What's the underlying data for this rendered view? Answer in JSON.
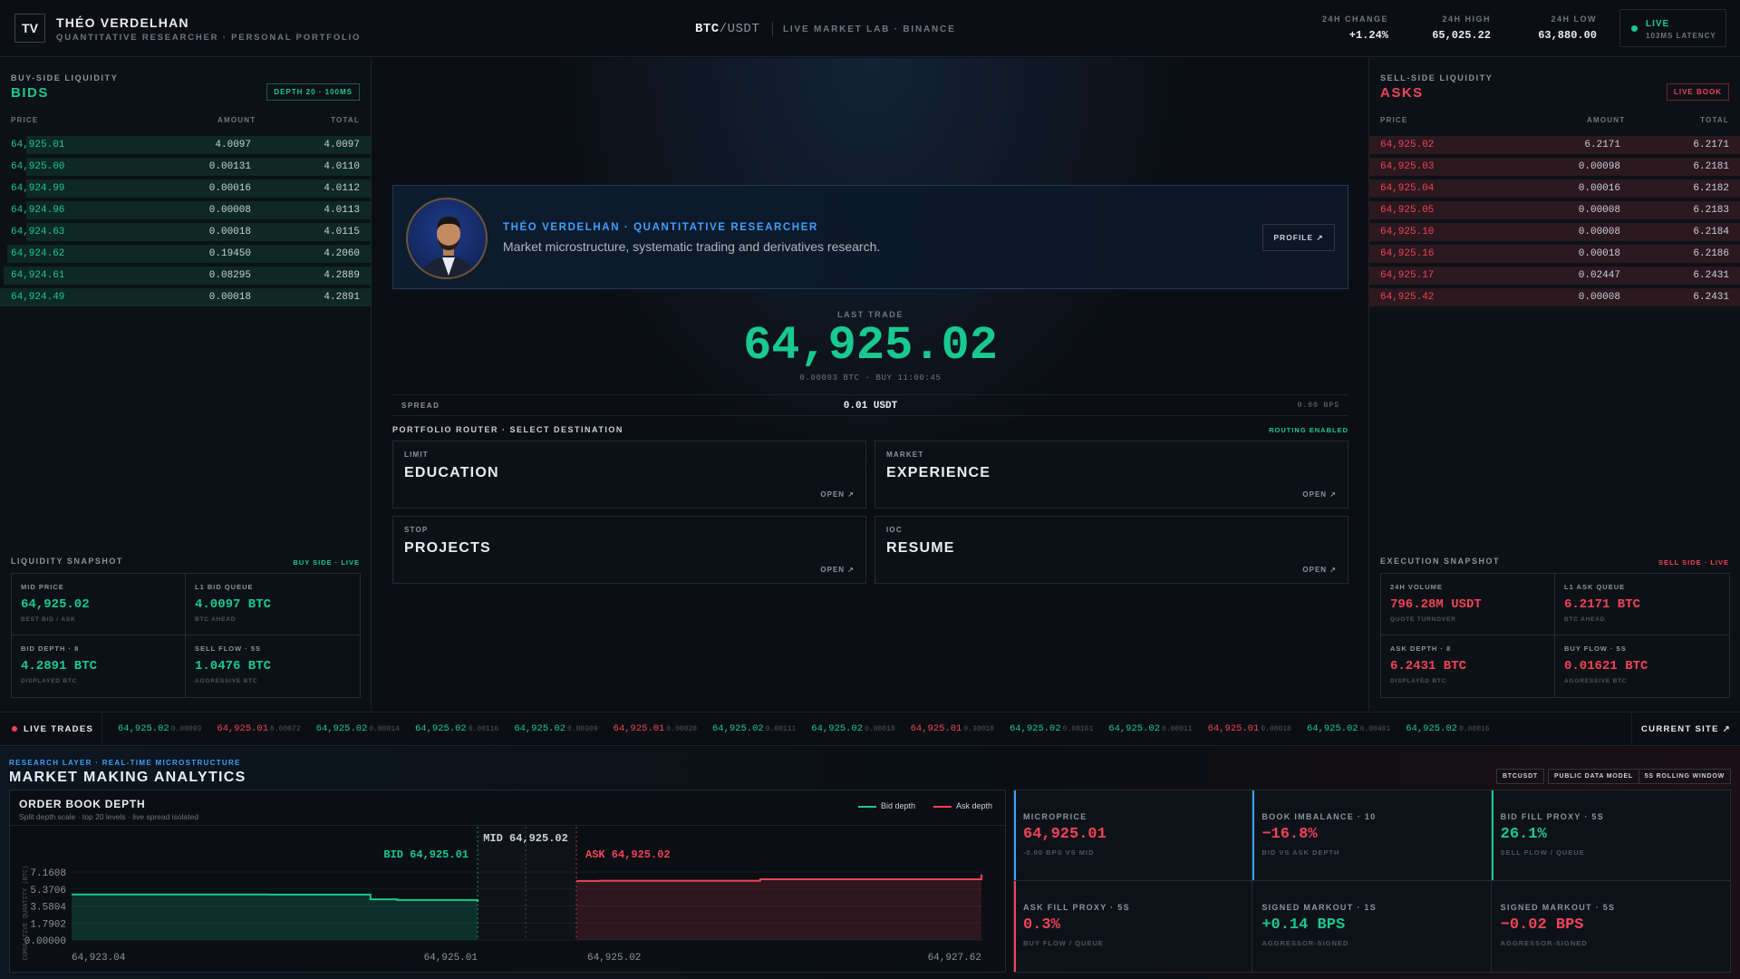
{
  "header": {
    "logo": "TV",
    "name": "THÉO VERDELHAN",
    "subtitle": "QUANTITATIVE RESEARCHER · PERSONAL PORTFOLIO",
    "pair_base": "BTC",
    "pair_quote": "/USDT",
    "lab": "LIVE MARKET LAB · BINANCE",
    "stats": [
      {
        "label": "24H CHANGE",
        "value": "+1.24%"
      },
      {
        "label": "24H HIGH",
        "value": "65,025.22"
      },
      {
        "label": "24H LOW",
        "value": "63,880.00"
      }
    ],
    "live": "LIVE",
    "latency": "103MS LATENCY"
  },
  "bids": {
    "kicker": "BUY-SIDE LIQUIDITY",
    "title": "BIDS",
    "badge": "DEPTH 20 · 100MS",
    "cols": [
      "PRICE",
      "AMOUNT",
      "TOTAL"
    ],
    "rows": [
      {
        "p": "64,925.01",
        "a": "4.0097",
        "t": "4.0097",
        "f": 0.93
      },
      {
        "p": "64,925.00",
        "a": "0.00131",
        "t": "4.0110",
        "f": 0.93
      },
      {
        "p": "64,924.99",
        "a": "0.00016",
        "t": "4.0112",
        "f": 0.93
      },
      {
        "p": "64,924.96",
        "a": "0.00008",
        "t": "4.0113",
        "f": 0.93
      },
      {
        "p": "64,924.63",
        "a": "0.00018",
        "t": "4.0115",
        "f": 0.93
      },
      {
        "p": "64,924.62",
        "a": "0.19450",
        "t": "4.2060",
        "f": 0.98
      },
      {
        "p": "64,924.61",
        "a": "0.08295",
        "t": "4.2889",
        "f": 0.99
      },
      {
        "p": "64,924.49",
        "a": "0.00018",
        "t": "4.2891",
        "f": 1.0
      }
    ],
    "snap_title": "LIQUIDITY SNAPSHOT",
    "snap_badge": "BUY SIDE · LIVE",
    "snap": [
      {
        "l": "MID PRICE",
        "v": "64,925.02",
        "s": "BEST BID / ASK"
      },
      {
        "l": "L1 BID QUEUE",
        "v": "4.0097 BTC",
        "s": "BTC AHEAD"
      },
      {
        "l": "BID DEPTH · 8",
        "v": "4.2891 BTC",
        "s": "DISPLAYED BTC"
      },
      {
        "l": "SELL FLOW · 5S",
        "v": "1.0476 BTC",
        "s": "AGGRESSIVE BTC"
      }
    ]
  },
  "asks": {
    "kicker": "SELL-SIDE LIQUIDITY",
    "title": "ASKS",
    "badge": "LIVE BOOK",
    "cols": [
      "PRICE",
      "AMOUNT",
      "TOTAL"
    ],
    "rows": [
      {
        "p": "64,925.02",
        "a": "6.2171",
        "t": "6.2171",
        "f": 1.0
      },
      {
        "p": "64,925.03",
        "a": "0.00098",
        "t": "6.2181",
        "f": 1.0
      },
      {
        "p": "64,925.04",
        "a": "0.00016",
        "t": "6.2182",
        "f": 1.0
      },
      {
        "p": "64,925.05",
        "a": "0.00008",
        "t": "6.2183",
        "f": 1.0
      },
      {
        "p": "64,925.10",
        "a": "0.00008",
        "t": "6.2184",
        "f": 1.0
      },
      {
        "p": "64,925.16",
        "a": "0.00018",
        "t": "6.2186",
        "f": 1.0
      },
      {
        "p": "64,925.17",
        "a": "0.02447",
        "t": "6.2431",
        "f": 1.0
      },
      {
        "p": "64,925.42",
        "a": "0.00008",
        "t": "6.2431",
        "f": 1.0
      }
    ],
    "snap_title": "EXECUTION SNAPSHOT",
    "snap_badge": "SELL SIDE · LIVE",
    "snap": [
      {
        "l": "24H VOLUME",
        "v": "796.28M USDT",
        "s": "QUOTE TURNOVER"
      },
      {
        "l": "L1 ASK QUEUE",
        "v": "6.2171 BTC",
        "s": "BTC AHEAD"
      },
      {
        "l": "ASK DEPTH · 8",
        "v": "6.2431 BTC",
        "s": "DISPLAYED BTC"
      },
      {
        "l": "BUY FLOW · 5S",
        "v": "0.01621 BTC",
        "s": "AGGRESSIVE BTC"
      }
    ]
  },
  "profile": {
    "name": "THÉO VERDELHAN · QUANTITATIVE RESEARCHER",
    "desc": "Market microstructure, systematic trading and derivatives research.",
    "button": "PROFILE ↗"
  },
  "trade": {
    "label": "LAST TRADE",
    "price": "64,925.02",
    "meta": "0.00093 BTC · BUY 11:00:45",
    "spread_label": "SPREAD",
    "spread": "0.01 USDT",
    "spread_bps": "0.00 BPS"
  },
  "router": {
    "title": "PORTFOLIO ROUTER · SELECT DESTINATION",
    "badge": "ROUTING ENABLED",
    "items": [
      {
        "kind": "LIMIT",
        "name": "EDUCATION",
        "open": "OPEN ↗"
      },
      {
        "kind": "MARKET",
        "name": "EXPERIENCE",
        "open": "OPEN ↗"
      },
      {
        "kind": "STOP",
        "name": "PROJECTS",
        "open": "OPEN ↗"
      },
      {
        "kind": "IOC",
        "name": "RESUME",
        "open": "OPEN ↗"
      }
    ]
  },
  "ticker": {
    "label": "LIVE TRADES",
    "current": "CURRENT SITE ↗",
    "items": [
      {
        "p": "64,925.02",
        "q": "0.00093",
        "side": "buy"
      },
      {
        "p": "64,925.01",
        "q": "0.00072",
        "side": "sell"
      },
      {
        "p": "64,925.02",
        "q": "0.00014",
        "side": "buy"
      },
      {
        "p": "64,925.02",
        "q": "0.00116",
        "side": "buy"
      },
      {
        "p": "64,925.02",
        "q": "0.00309",
        "side": "buy"
      },
      {
        "p": "64,925.01",
        "q": "0.00020",
        "side": "sell"
      },
      {
        "p": "64,925.02",
        "q": "0.00111",
        "side": "buy"
      },
      {
        "p": "64,925.02",
        "q": "0.00018",
        "side": "buy"
      },
      {
        "p": "64,925.01",
        "q": "0.30018",
        "side": "sell"
      },
      {
        "p": "64,925.02",
        "q": "0.00161",
        "side": "buy"
      },
      {
        "p": "64,925.02",
        "q": "0.00011",
        "side": "buy"
      },
      {
        "p": "64,925.01",
        "q": "0.00018",
        "side": "sell"
      },
      {
        "p": "64,925.02",
        "q": "0.00401",
        "side": "buy"
      },
      {
        "p": "64,925.02",
        "q": "0.00016",
        "side": "buy"
      }
    ]
  },
  "analytics": {
    "tag": "RESEARCH LAYER · REAL-TIME MICROSTRUCTURE",
    "title": "MARKET MAKING ANALYTICS",
    "chips": [
      "BTCUSDT",
      "PUBLIC DATA MODEL",
      "5S ROLLING WINDOW"
    ],
    "metrics": [
      {
        "l": "MICROPRICE",
        "v": "64,925.01",
        "s": "-0.00 BPS VS MID",
        "c": "red",
        "a": "#3ea0ff"
      },
      {
        "l": "BOOK IMBALANCE · 10",
        "v": "−16.8%",
        "s": "BID VS ASK DEPTH",
        "c": "red",
        "a": "#3ea0ff"
      },
      {
        "l": "BID FILL PROXY · 5S",
        "v": "26.1%",
        "s": "SELL FLOW / QUEUE",
        "c": "green",
        "a": "#19c98f"
      },
      {
        "l": "ASK FILL PROXY · 5S",
        "v": "0.3%",
        "s": "BUY FLOW / QUEUE",
        "c": "red",
        "a": "#f0445a"
      },
      {
        "l": "SIGNED MARKOUT · 1S",
        "v": "+0.14 BPS",
        "s": "AGGRESSOR-SIGNED",
        "c": "green",
        "a": "none"
      },
      {
        "l": "SIGNED MARKOUT · 5S",
        "v": "−0.02 BPS",
        "s": "AGGRESSOR-SIGNED",
        "c": "red",
        "a": "none"
      }
    ]
  },
  "chart_data": {
    "type": "area",
    "title": "ORDER BOOK DEPTH",
    "subtitle": "Split depth scale · top 20 levels · live spread isolated",
    "ylabel": "CUMULATIVE QUANTITY (BTC)",
    "legend": [
      "Bid depth",
      "Ask depth"
    ],
    "bid_color": "#19c98f",
    "ask_color": "#f0445a",
    "yticks": [
      "7.1608",
      "5.3706",
      "3.5804",
      "1.7902",
      "0.00000"
    ],
    "ylim": [
      0,
      7.1608
    ],
    "xticks_left": [
      "64,923.04",
      "64,925.01"
    ],
    "xticks_right": [
      "64,925.02",
      "64,927.62"
    ],
    "mid_label": "MID 64,925.02",
    "bid_label": "BID 64,925.01",
    "ask_label": "ASK 64,925.02",
    "bid_series": [
      {
        "x": 64923.04,
        "y": 4.8
      },
      {
        "x": 64924.0,
        "y": 4.78
      },
      {
        "x": 64924.49,
        "y": 4.29
      },
      {
        "x": 64924.62,
        "y": 4.21
      },
      {
        "x": 64925.01,
        "y": 4.01
      }
    ],
    "ask_series": [
      {
        "x": 64925.02,
        "y": 6.22
      },
      {
        "x": 64925.17,
        "y": 6.24
      },
      {
        "x": 64926.2,
        "y": 6.4
      },
      {
        "x": 64927.62,
        "y": 6.9
      }
    ]
  }
}
